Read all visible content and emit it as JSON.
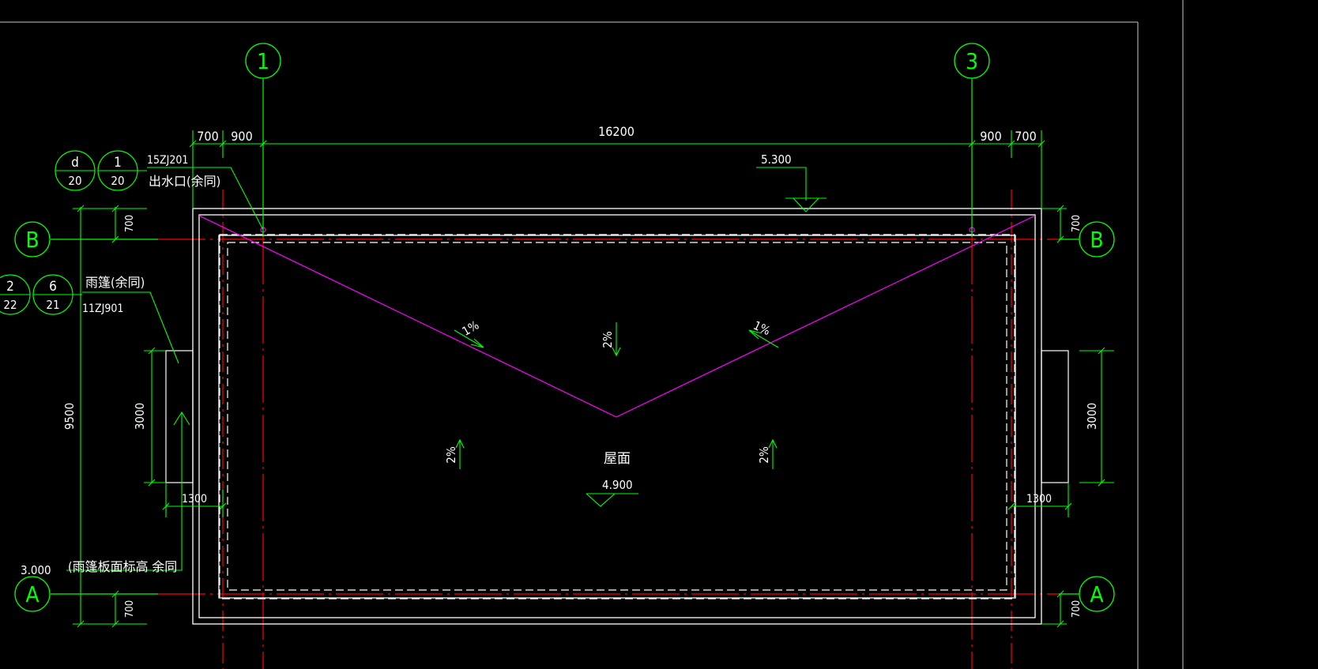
{
  "grid_labels": {
    "col_left": "1",
    "col_right": "3",
    "row_top_left": "B",
    "row_top_right": "B",
    "row_bottom_left": "A",
    "row_bottom_right": "A"
  },
  "dimensions": {
    "top_700_left": "700",
    "top_900_left": "900",
    "top_16200": "16200",
    "top_900_right": "900",
    "top_700_right": "700",
    "left_700_top": "700",
    "left_9500": "9500",
    "left_3000": "3000",
    "left_700_bottom": "700",
    "left_1300": "1300",
    "right_700_top": "700",
    "right_3000": "3000",
    "right_1300": "1300",
    "right_700_bottom": "700"
  },
  "detail_bubbles": {
    "d1_top": "d",
    "d1_bottom": "20",
    "d2_top": "1",
    "d2_bottom": "20",
    "d3_top": "2",
    "d3_bottom": "22",
    "d4_top": "6",
    "d4_bottom": "21"
  },
  "annotations": {
    "std_15zj201": "15ZJ201",
    "outlet_note": "出水口(余同)",
    "canopy_note": "雨篷(余同)",
    "std_11zj901": "11ZJ901",
    "canopy_elev": "3.000",
    "canopy_elev_note": "(雨篷板面标高 余同",
    "roof_label": "屋面",
    "roof_elev": "4.900",
    "parapet_elev": "5.300"
  },
  "slopes": {
    "slope_left_diag": "1%",
    "slope_right_diag": "1%",
    "slope_top_center": "2%",
    "slope_mid_left": "2%",
    "slope_mid_right": "2%"
  },
  "colors": {
    "background": "#000000",
    "green": "#00ff00",
    "white": "#ffffff",
    "red": "#ff0000",
    "magenta": "#ff00ff",
    "gray_frame": "#c8c8c8"
  }
}
